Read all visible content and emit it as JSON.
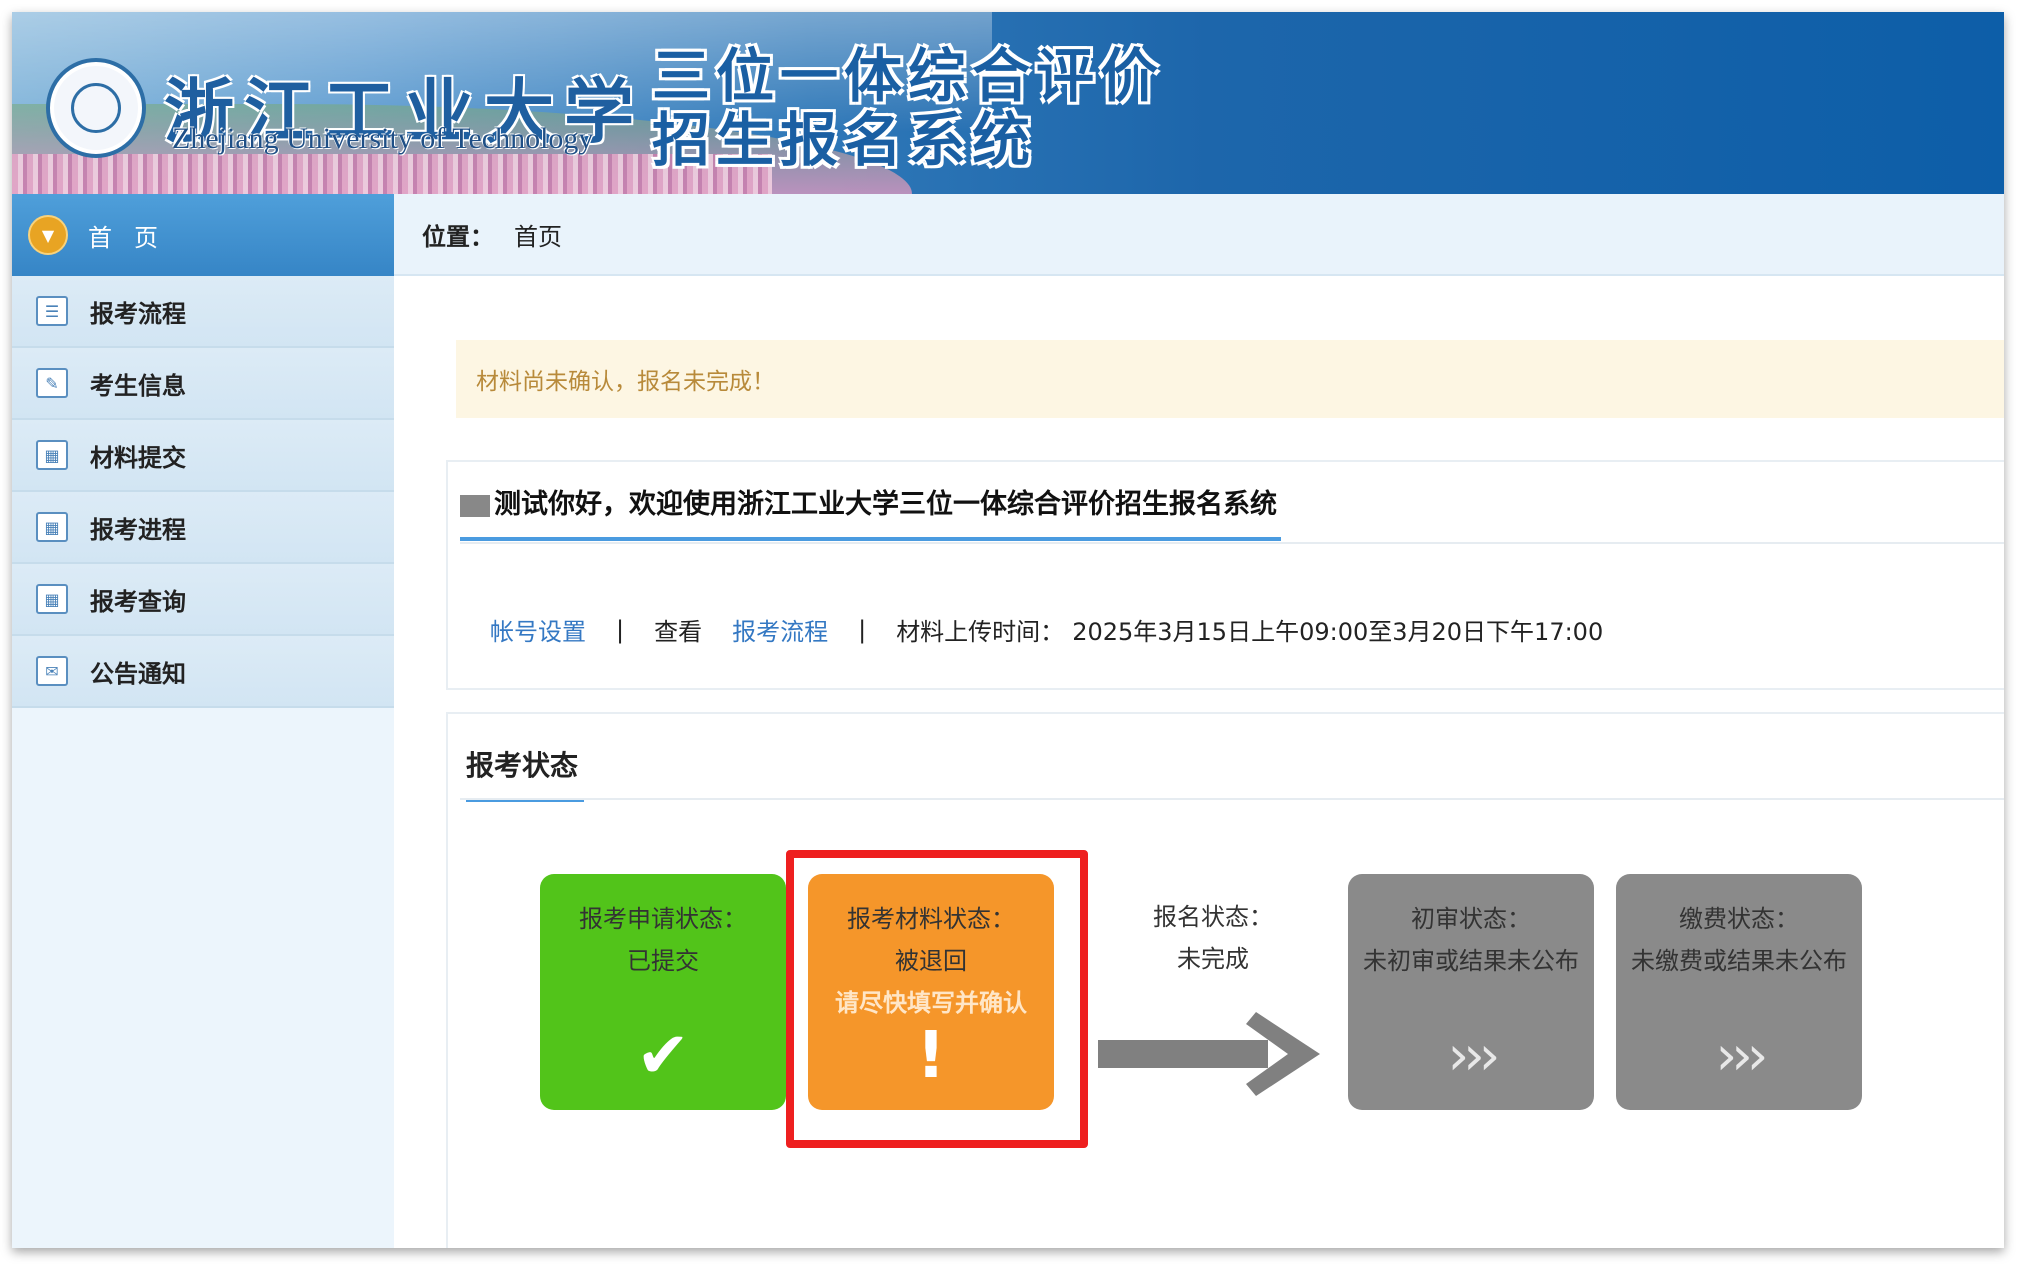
{
  "header": {
    "university_name": "浙江工业大学",
    "university_en": "Zhejiang University of Technology",
    "system_name_line1": "三位一体综合评价",
    "system_name_line2": "招生报名系统"
  },
  "sidebar": {
    "home": {
      "label": "首页",
      "icon": "chevron-down-icon"
    },
    "items": [
      {
        "label": "报考流程",
        "icon": "list-icon"
      },
      {
        "label": "考生信息",
        "icon": "edit-icon"
      },
      {
        "label": "材料提交",
        "icon": "calendar-icon"
      },
      {
        "label": "报考进程",
        "icon": "calendar-icon"
      },
      {
        "label": "报考查询",
        "icon": "calendar-icon"
      },
      {
        "label": "公告通知",
        "icon": "message-icon"
      }
    ]
  },
  "breadcrumb": {
    "prefix": "位置：",
    "current": "首页"
  },
  "alert": {
    "text": "材料尚未确认，报名未完成！"
  },
  "welcome": {
    "title": "测试你好，欢迎使用浙江工业大学三位一体综合评价招生报名系统",
    "account_link": "帐号设置",
    "separator": "|",
    "view_text": "查看",
    "process_link": "报考流程",
    "upload_time": "材料上传时间：",
    "upload_time_value": "2025年3月15日上午09:00至3月20日下午17:00"
  },
  "status": {
    "title": "报考状态",
    "apply": {
      "label": "报考申请状态：",
      "value": "已提交",
      "symbol": "✔",
      "color": "#52c41a"
    },
    "material": {
      "label": "报考材料状态：",
      "value": "被退回",
      "warning": "请尽快填写并确认",
      "symbol": "!",
      "color": "#f5962a"
    },
    "signup": {
      "label": "报名状态：",
      "value": "未完成"
    },
    "review": {
      "label": "初审状态：",
      "value": "未初审或结果未公布",
      "symbol": "›››"
    },
    "fee": {
      "label": "缴费状态：",
      "value": "未缴费或结果未公布",
      "symbol": "›››"
    }
  },
  "colors": {
    "accent": "#3685c6",
    "highlight": "#ee1f1f",
    "link": "#3478c3"
  }
}
